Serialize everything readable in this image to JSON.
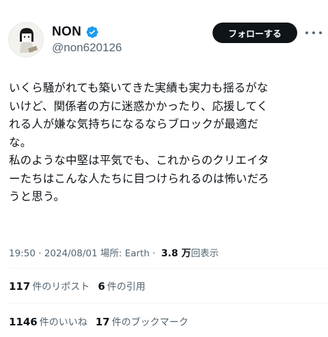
{
  "author": {
    "display_name": "NON",
    "handle": "@non620126",
    "verified_icon": "verified-badge-icon",
    "avatar_icon": "avatar-illustration"
  },
  "actions": {
    "follow_label": "フォローする",
    "more_icon": "more-options-icon"
  },
  "tweet": {
    "lines": [
      "いくら騒がれても築いてきた実績も実力も揺るがな",
      "いけど、関係者の方に迷惑かかったり、応援してく",
      "れる人が嫌な気持ちになるならブロックが最適だ",
      "な。",
      "私のような中堅は平気でも、これからのクリエイタ",
      "ーたちはこんな人たちに目つけられるのは怖いだろ",
      "うと思う。"
    ]
  },
  "meta": {
    "time": "19:50",
    "sep1": " · ",
    "date": "2024/08/01",
    "location_prefix": " 場所: ",
    "location": "Earth",
    "sep2": " · ",
    "views_count": "3.8 万",
    "views_label": "回表示"
  },
  "stats": {
    "reposts_num": "117",
    "reposts_label": "件のリポスト",
    "quotes_num": "6",
    "quotes_label": "件の引用",
    "likes_num": "1146",
    "likes_label": "件のいいね",
    "bookmarks_num": "17",
    "bookmarks_label": "件のブックマーク"
  },
  "colors": {
    "text": "#0f1419",
    "secondary": "#536471",
    "verified": "#1d9bf0",
    "divider": "#eff3f4"
  }
}
